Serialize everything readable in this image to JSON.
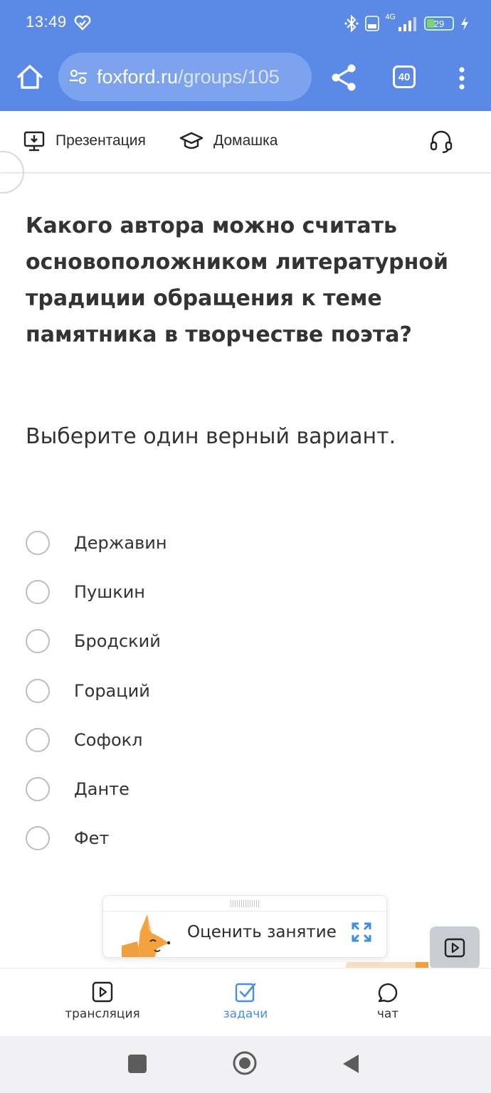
{
  "status_bar": {
    "time": "13:49",
    "battery": "29",
    "network": "4G"
  },
  "browser": {
    "url_domain": "foxford.ru",
    "url_path": "/groups/105",
    "tab_count": "40"
  },
  "toolbar": {
    "presentation_label": "Презентация",
    "homework_label": "Домашка"
  },
  "question": {
    "text": "Какого автора можно считать основоположником литературной традиции обращения к теме памятника в творчестве поэта?",
    "instruction": "Выберите один верный вариант.",
    "options": [
      "Державин",
      "Пушкин",
      "Бродский",
      "Гораций",
      "Софокл",
      "Данте",
      "Фет"
    ]
  },
  "rate_panel": {
    "label": "Оценить занятие"
  },
  "bottom_nav": {
    "broadcast": "трансляция",
    "tasks": "задачи",
    "chat": "чат",
    "active": "tasks"
  },
  "colors": {
    "header_blue": "#5b89e6",
    "url_pill": "#7ea3ee",
    "accent_blue": "#4a8ee6",
    "fox_orange": "#f0a03a"
  }
}
